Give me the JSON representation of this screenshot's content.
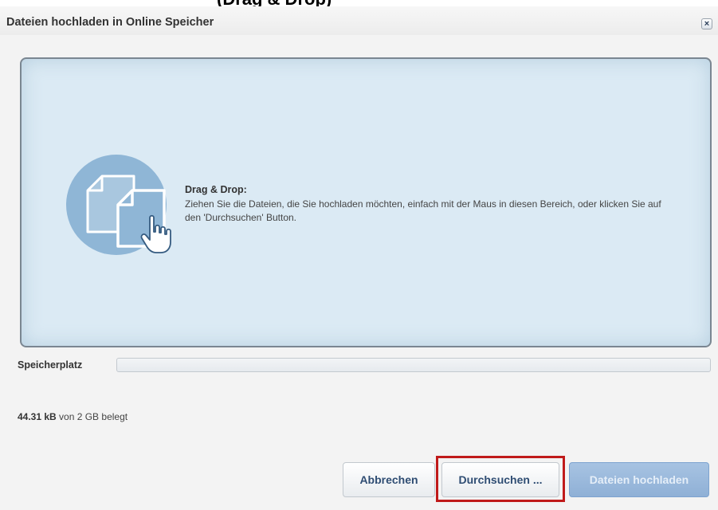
{
  "top_cut_text": "(Drag & Drop)",
  "dialog": {
    "title": "Dateien hochladen in Online Speicher",
    "close_glyph": "×"
  },
  "drop_zone": {
    "title": "Drag & Drop:",
    "text": "Ziehen Sie die Dateien, die Sie hochladen möchten, einfach mit der Maus in diesen Bereich, oder klicken Sie auf den 'Durchsuchen' Button.",
    "icon": "documents-drag-hand-icon",
    "colors": {
      "background": "#dbeaf4",
      "circle": "#8fb6d6",
      "border": "#7a8691"
    }
  },
  "storage": {
    "label": "Speicherplatz",
    "used_fraction": 0.0
  },
  "usage": {
    "used": "44.31 kB",
    "rest": " von 2 GB belegt"
  },
  "buttons": {
    "cancel": "Abbrechen",
    "browse": "Durchsuchen ...",
    "upload": "Dateien hochladen"
  },
  "highlight_color": "#c01a1a"
}
